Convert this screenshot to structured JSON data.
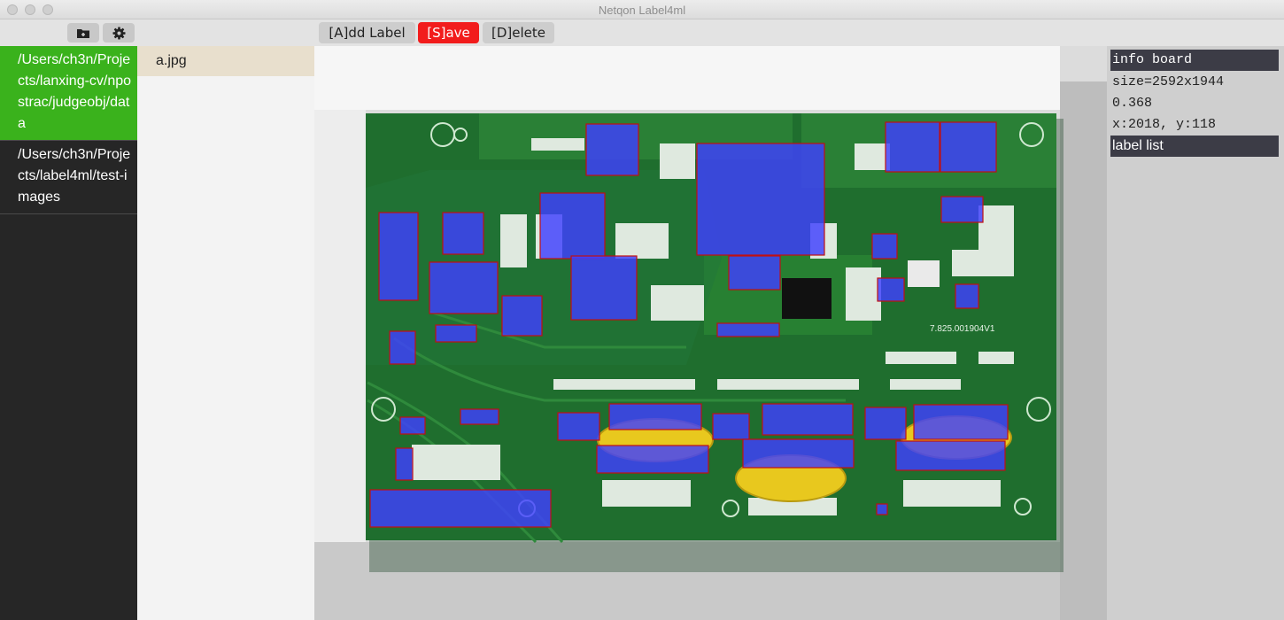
{
  "window": {
    "title": "Netqon Label4ml"
  },
  "toolbar": {
    "add_label": "[A]dd Label",
    "save": "[S]ave",
    "delete": "[D]elete",
    "open_folder_icon": "folder-plus-icon",
    "settings_icon": "gear-icon"
  },
  "sidebar": {
    "folders": [
      {
        "path": "/Users/ch3n/Projects/lanxing-cv/npostrac/judgeobj/data",
        "active": true
      },
      {
        "path": "/Users/ch3n/Projects/label4ml/test-images",
        "active": false
      }
    ]
  },
  "files": {
    "items": [
      {
        "name": "a.jpg",
        "active": true
      }
    ]
  },
  "info_board": {
    "title": "info board",
    "size": "size=2592x1944",
    "scale": "0.368",
    "coords": "x:2018, y:118",
    "label_list_title": "label list"
  },
  "colors": {
    "active_folder": "#3ab21c",
    "save_button": "#f21c1c",
    "pcb_green": "#1f6e2e",
    "label_fill": "#4040ff",
    "label_border": "#c01010"
  }
}
